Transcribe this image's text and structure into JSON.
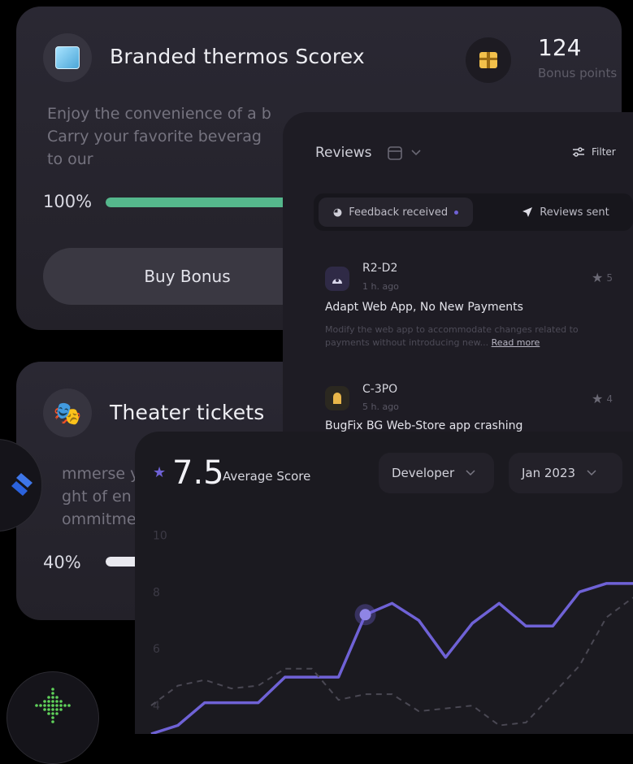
{
  "product_card": {
    "title": "Branded thermos Scorex",
    "description_line1": "Enjoy the convenience of a b",
    "description_line2": "Carry your favorite beverag",
    "description_line3": "to our",
    "progress_label": "100%",
    "progress_value": 1.0,
    "progress_color": "#55b78c",
    "buy_label": "Buy Bonus",
    "points_value": "124",
    "points_label": "Bonus points",
    "icon": "ice-cube-icon",
    "gift_icon": "gift-icon"
  },
  "theater_card": {
    "title": "Theater tickets",
    "description_line1": "mmerse y",
    "description_line2": "ght of en",
    "description_line3": "ommitme",
    "progress_label": "40%",
    "progress_value": 0.4,
    "progress_color": "#e9e9ef",
    "icon": "theater-masks-icon"
  },
  "reviews": {
    "title": "Reviews",
    "filter_label": "Filter",
    "tab_received": "Feedback received",
    "tab_sent": "Reviews sent",
    "items": [
      {
        "author": "R2-D2",
        "time": "1 h. ago",
        "title": "Adapt Web App, No New Payments",
        "body_line1": "Modify the web app to accommodate changes related to",
        "body_line2": "payments without introducing new...",
        "read_more": "Read more",
        "rating": "5"
      },
      {
        "author": "C-3PO",
        "time": "5 h. ago",
        "title": "BugFix BG Web-Store app crashing",
        "rating": "4"
      }
    ]
  },
  "score": {
    "value": "7.5",
    "label": "Average Score",
    "role_select": "Developer",
    "month_select": "Jan 2023",
    "accent": "#6f62d6"
  },
  "chart_data": {
    "type": "line",
    "yticks": [
      "10",
      "8",
      "6",
      "4"
    ],
    "ylim": [
      3,
      10.5
    ],
    "x": [
      0,
      1,
      2,
      3,
      4,
      5,
      6,
      7,
      8,
      9,
      10,
      11,
      12,
      13,
      14,
      15,
      16,
      17,
      18
    ],
    "series": [
      {
        "style": "solid",
        "values": [
          3.0,
          3.3,
          4.1,
          4.1,
          4.1,
          5.0,
          5.0,
          5.0,
          7.2,
          7.6,
          7.0,
          5.7,
          6.9,
          7.6,
          6.8,
          6.8,
          8.0,
          8.3,
          8.3
        ]
      },
      {
        "style": "dashed",
        "values": [
          4.0,
          4.7,
          4.9,
          4.6,
          4.7,
          5.3,
          5.3,
          4.2,
          4.4,
          4.4,
          3.8,
          3.9,
          4.0,
          3.3,
          3.4,
          4.4,
          5.4,
          7.1,
          7.8
        ]
      }
    ],
    "highlight_index": 8,
    "grid": false
  }
}
